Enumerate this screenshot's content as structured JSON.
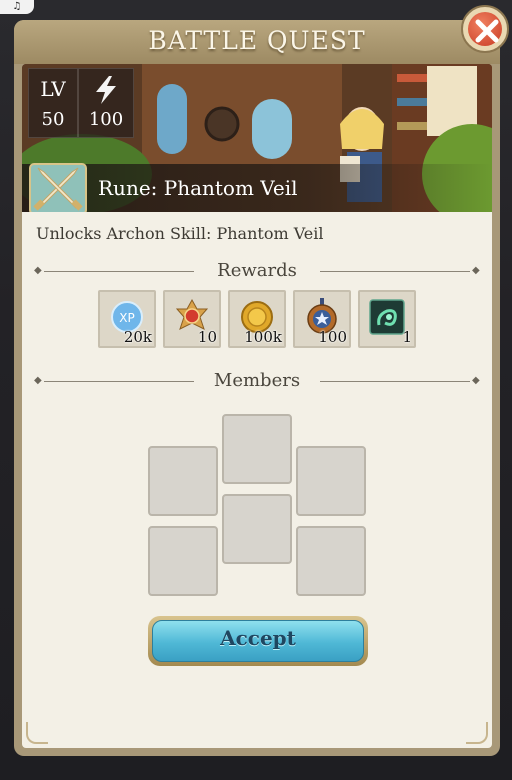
{
  "status_bar": {
    "music_icon": "♫"
  },
  "quest": {
    "title": "BATTLE QUEST",
    "level_label": "LV",
    "level_value": "50",
    "energy_value": "100",
    "rune_name": "Rune: Phantom Veil",
    "unlock_text": "Unlocks Archon Skill: Phantom Veil"
  },
  "rewards": {
    "heading": "Rewards",
    "items": [
      {
        "icon": "xp-orb-icon",
        "qty": "20k"
      },
      {
        "icon": "red-gem-medal-icon",
        "qty": "10"
      },
      {
        "icon": "gold-coin-icon",
        "qty": "100k"
      },
      {
        "icon": "blue-star-medal-icon",
        "qty": "100"
      },
      {
        "icon": "green-rune-icon",
        "qty": "1"
      }
    ],
    "xp_badge": "XP"
  },
  "members": {
    "heading": "Members"
  },
  "actions": {
    "accept_label": "Accept"
  },
  "colors": {
    "accent_button": "#4fb8d6",
    "panel_frame": "#a89878",
    "close": "#c83b24"
  }
}
